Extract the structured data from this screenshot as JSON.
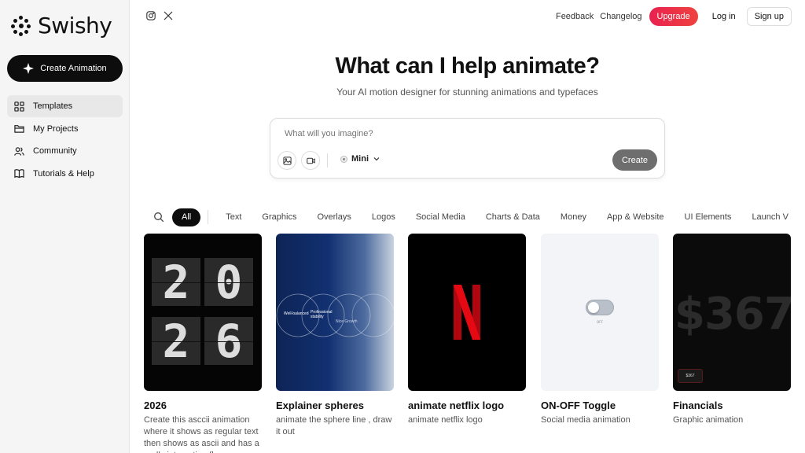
{
  "app": {
    "name": "Swishy"
  },
  "sidebar": {
    "create_label": "Create Animation",
    "items": [
      {
        "label": "Templates",
        "icon": "grid-icon",
        "active": true
      },
      {
        "label": "My Projects",
        "icon": "folder-icon",
        "active": false
      },
      {
        "label": "Community",
        "icon": "users-icon",
        "active": false
      },
      {
        "label": "Tutorials & Help",
        "icon": "book-icon",
        "active": false
      }
    ]
  },
  "header": {
    "social": [
      "instagram-icon",
      "x-icon"
    ],
    "feedback": "Feedback",
    "changelog": "Changelog",
    "upgrade": "Upgrade",
    "login": "Log in",
    "signup": "Sign up",
    "upgrade_color": "#e8224f"
  },
  "hero": {
    "title": "What can I help animate?",
    "subtitle": "Your AI motion designer for stunning animations and typefaces"
  },
  "prompt": {
    "placeholder": "What will you imagine?",
    "model": "Mini",
    "create_label": "Create"
  },
  "filters": {
    "active": "All",
    "items": [
      "Text",
      "Graphics",
      "Overlays",
      "Logos",
      "Social Media",
      "Charts & Data",
      "Money",
      "App & Website",
      "UI Elements",
      "Launch V"
    ]
  },
  "cards": [
    {
      "title": "2026",
      "description": "Create this asccii animation where it shows as regular text then shows as ascii and has a really interesting flow",
      "digits": [
        "2",
        "0",
        "2",
        "6"
      ]
    },
    {
      "title": "Explainer spheres",
      "description": "animate the sphere line , draw it out",
      "labels": [
        "Well-balanced",
        "Professional stability",
        "Nice Growth"
      ]
    },
    {
      "title": "animate netflix logo",
      "description": "animate netflix logo",
      "logo_letter": "N",
      "logo_color": "#e50914"
    },
    {
      "title": "ON-OFF Toggle",
      "description": "Social media animation",
      "toggle_label": "OFF"
    },
    {
      "title": "Financials",
      "description": "Graphic animation",
      "big_value": "$367",
      "chip_value": "$367"
    }
  ]
}
